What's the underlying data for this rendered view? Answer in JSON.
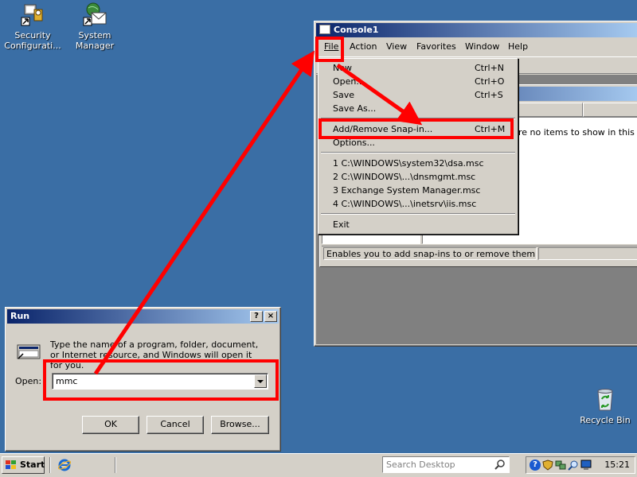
{
  "desktop": {
    "icons": [
      {
        "label": "Security Configurati...",
        "icon": "security-configuration-icon"
      },
      {
        "label": "System Manager",
        "icon": "system-manager-icon"
      },
      {
        "label": "Recycle Bin",
        "icon": "recycle-bin-icon"
      }
    ]
  },
  "console": {
    "title": "Console1",
    "menu": [
      "File",
      "Action",
      "View",
      "Favorites",
      "Window",
      "Help"
    ],
    "empty_text": "re no items to show in this view",
    "status_text": "Enables you to add snap-ins to or remove them from th"
  },
  "file_menu": {
    "items": [
      {
        "label": "New",
        "shortcut": "Ctrl+N"
      },
      {
        "label": "Open...",
        "shortcut": "Ctrl+O"
      },
      {
        "label": "Save",
        "shortcut": "Ctrl+S"
      },
      {
        "label": "Save As...",
        "shortcut": ""
      },
      {
        "label": "Add/Remove Snap-in...",
        "shortcut": "Ctrl+M"
      },
      {
        "label": "Options...",
        "shortcut": ""
      },
      {
        "label": "1 C:\\WINDOWS\\system32\\dsa.msc",
        "shortcut": ""
      },
      {
        "label": "2 C:\\WINDOWS\\...\\dnsmgmt.msc",
        "shortcut": ""
      },
      {
        "label": "3 Exchange System Manager.msc",
        "shortcut": ""
      },
      {
        "label": "4 C:\\WINDOWS\\...\\inetsrv\\iis.msc",
        "shortcut": ""
      },
      {
        "label": "Exit",
        "shortcut": ""
      }
    ]
  },
  "run_dialog": {
    "title": "Run",
    "help_btn": "?",
    "close_btn": "×",
    "description": "Type the name of a program, folder, document, or Internet resource, and Windows will open it for you.",
    "open_label": "Open:",
    "open_value": "mmc",
    "ok_label": "OK",
    "cancel_label": "Cancel",
    "browse_label": "Browse..."
  },
  "taskbar": {
    "start_label": "Start",
    "search_placeholder": "Search Desktop",
    "clock": "15:21"
  },
  "colors": {
    "desktop": "#3a6ea5",
    "annotation": "#ff0000",
    "title_active": "#0a246a",
    "highlight": "#0a246a"
  }
}
